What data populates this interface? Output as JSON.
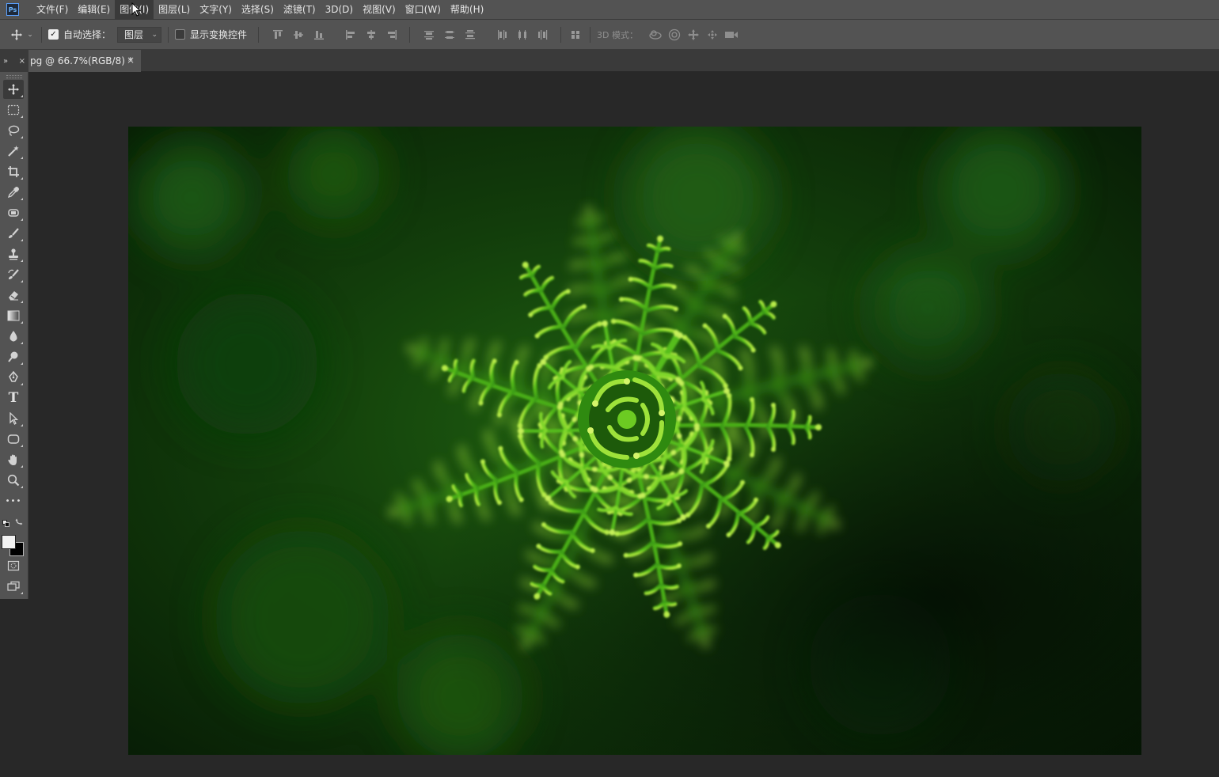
{
  "menubar": {
    "logo": "Ps",
    "items": [
      "文件(F)",
      "编辑(E)",
      "图像(I)",
      "图层(L)",
      "文字(Y)",
      "选择(S)",
      "滤镜(T)",
      "3D(D)",
      "视图(V)",
      "窗口(W)",
      "帮助(H)"
    ]
  },
  "options": {
    "auto_select_label": "自动选择：",
    "auto_select_checked": true,
    "auto_select_target": "图层",
    "show_transform_label": "显示变换控件",
    "show_transform_checked": false,
    "mode_3d_label": "3D 模式："
  },
  "document": {
    "tab_title": "pg @ 66.7%(RGB/8) *",
    "close_glyph": "×"
  },
  "panel_header": {
    "collapse_glyph": "»",
    "close_glyph": "×"
  },
  "tools": [
    "move-tool",
    "rectangular-marquee-tool",
    "lasso-tool",
    "magic-wand-tool",
    "crop-tool",
    "eyedropper-tool",
    "spot-healing-tool",
    "brush-tool",
    "clone-stamp-tool",
    "history-brush-tool",
    "eraser-tool",
    "gradient-tool",
    "blur-tool",
    "dodge-tool",
    "pen-tool",
    "type-tool",
    "path-selection-tool",
    "shape-tool",
    "hand-tool",
    "zoom-tool",
    "more-tools"
  ],
  "type_tool_glyph": "T",
  "more_tools_glyph": "•••",
  "colors": {
    "foreground": "#f2f2f2",
    "background": "#000000",
    "ui_panel": "#535353",
    "ui_dark": "#282828",
    "fern_bright": "#7fd62a",
    "fern_mid": "#3f9e12",
    "bg_green": "#0f3a0b"
  }
}
